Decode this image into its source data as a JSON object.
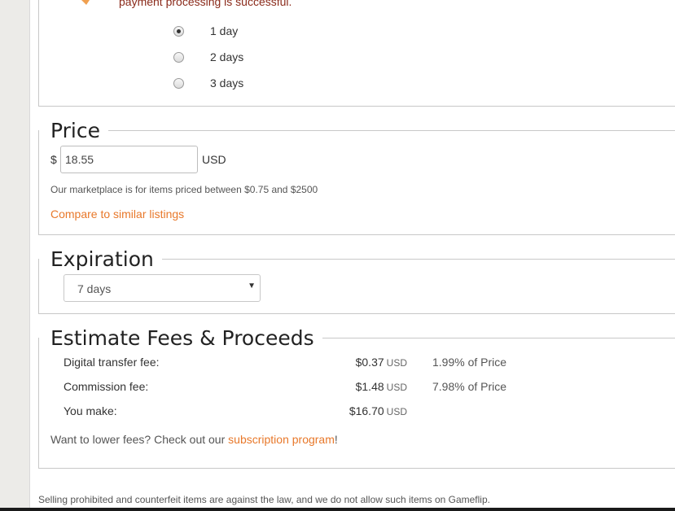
{
  "delivery": {
    "notice_text": "payment processing is successful.",
    "options": [
      {
        "label": "1 day",
        "checked": true
      },
      {
        "label": "2 days",
        "checked": false
      },
      {
        "label": "3 days",
        "checked": false
      }
    ]
  },
  "price": {
    "title": "Price",
    "currency_symbol": "$",
    "value": "18.55",
    "currency": "USD",
    "hint": "Our marketplace is for items priced between $0.75 and $2500",
    "compare_link": "Compare to similar listings"
  },
  "expiration": {
    "title": "Expiration",
    "selected": "7 days"
  },
  "fees": {
    "title": "Estimate Fees & Proceeds",
    "rows": [
      {
        "label": "Digital transfer fee:",
        "amount": "$0.37",
        "currency": "USD",
        "percent": "1.99% of Price"
      },
      {
        "label": "Commission fee:",
        "amount": "$1.48",
        "currency": "USD",
        "percent": "7.98% of Price"
      },
      {
        "label": "You make:",
        "amount": "$16.70",
        "currency": "USD",
        "percent": ""
      }
    ],
    "cta_prefix": "Want to lower fees? Check out our ",
    "cta_link": "subscription program",
    "cta_suffix": "!"
  },
  "footer": {
    "note": "Selling prohibited and counterfeit items are against the law, and we do not allow such items on Gameflip."
  },
  "colors": {
    "accent": "#e8782a",
    "warning_text": "#8a2a1a"
  }
}
